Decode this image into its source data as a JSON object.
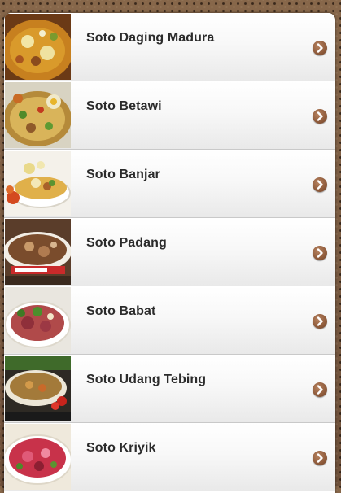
{
  "menu": {
    "items": [
      {
        "label": "Soto Daging Madura",
        "icon": "chevron-right-circle-icon"
      },
      {
        "label": "Soto Betawi",
        "icon": "chevron-right-circle-icon"
      },
      {
        "label": "Soto Banjar",
        "icon": "chevron-right-circle-icon"
      },
      {
        "label": "Soto Padang",
        "icon": "chevron-right-circle-icon"
      },
      {
        "label": "Soto Babat",
        "icon": "chevron-right-circle-icon"
      },
      {
        "label": "Soto Udang Tebing",
        "icon": "chevron-right-circle-icon"
      },
      {
        "label": "Soto Kriyik",
        "icon": "chevron-right-circle-icon"
      }
    ]
  },
  "colors": {
    "background": "#7a5a3f",
    "arrow": "#8e5a3a",
    "text": "#2b2b2b"
  }
}
